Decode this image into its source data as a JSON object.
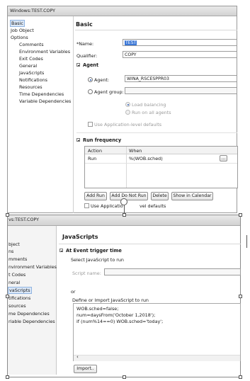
{
  "window1": {
    "title": "Windows:TEST.COPY",
    "tree": [
      "Basic",
      "Job Object",
      "Options",
      "Comments",
      "Environment Variables",
      "Exit Codes",
      "General",
      "JavaScripts",
      "Notifications",
      "Resources",
      "Time Dependencies",
      "Variable Dependencies"
    ],
    "header": "Basic",
    "name_label": "*Name:",
    "name_value": "TEST",
    "qualifier_label": "Qualifier:",
    "qualifier_value": "COPY",
    "agent_section": "Agent",
    "agent_radio_label": "Agent:",
    "agent_value": "WINA_RSCESPPR03",
    "agent_group_label": "Agent group:",
    "load_balancing": "Load balancing",
    "run_on_all": "Run on all agents",
    "use_app_defaults": "Use Application-level defaults",
    "run_freq_section": "Run frequency",
    "col_action": "Action",
    "col_when": "When",
    "row_action": "Run",
    "row_when": "%(WOB.sched)",
    "ellipsis": "...",
    "btn_add_run": "Add Run",
    "btn_add_do_not_run": "Add Do Not Run",
    "btn_delete": "Delete",
    "btn_show_calendar": "Show in Calendar",
    "use_app_defaults_2_a": "Use Applicatio",
    "use_app_defaults_2_b": "vel defaults"
  },
  "window2": {
    "title": "vs:TEST.COPY",
    "tree": [
      "bject",
      "ns",
      "mments",
      "nvironment Variables",
      "t Codes",
      "neral",
      "vaScripts",
      "tifications",
      "sources",
      "me Dependencies",
      "riable Dependencies"
    ],
    "header": "JavaScripts",
    "section": "At Event trigger time",
    "select_js": "Select JavaScript to run",
    "script_name_label": "Script name:",
    "or": "or",
    "define_import": "Define or Import JavaScript to run",
    "code_line1": "WOB.sched=false;",
    "code_line2": "num=daysFrom('October 1,2018');",
    "code_line3": "if (num%14==0) WOB.sched='today';",
    "scroll_left": "‹",
    "import_btn": "Import.."
  }
}
